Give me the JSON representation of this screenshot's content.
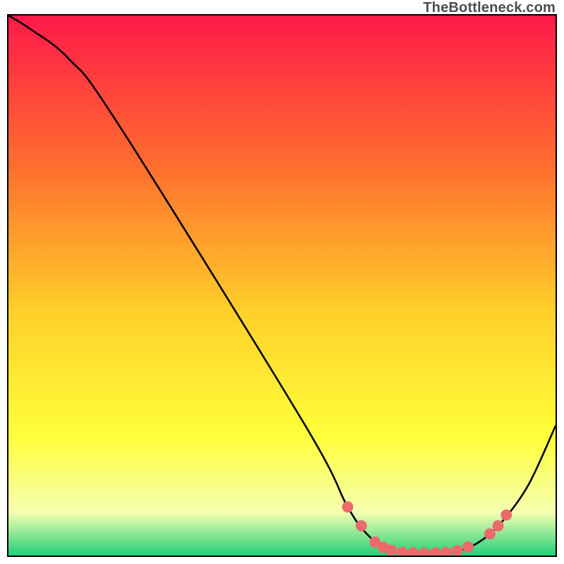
{
  "watermark": "TheBottleneck.com",
  "colors": {
    "border": "#000000",
    "curve": "#000000",
    "dot_fill": "#ec6a6a",
    "dot_stroke": "#a33b3b",
    "grad_top": "#ff1a4a",
    "grad_mid_upper": "#ff6e2e",
    "grad_mid": "#ffd02a",
    "grad_mid_lower": "#ffff3a",
    "grad_pale": "#f5ffb0",
    "grad_bottom": "#21d07a"
  },
  "chart_data": {
    "type": "line",
    "title": "",
    "xlabel": "",
    "ylabel": "",
    "xlim": [
      0,
      100
    ],
    "ylim": [
      0,
      100
    ],
    "curve": [
      {
        "x": 0,
        "y": 100
      },
      {
        "x": 4,
        "y": 97.5
      },
      {
        "x": 11,
        "y": 92
      },
      {
        "x": 20,
        "y": 80
      },
      {
        "x": 54,
        "y": 24.5
      },
      {
        "x": 62,
        "y": 9
      },
      {
        "x": 66,
        "y": 3.5
      },
      {
        "x": 70,
        "y": 1
      },
      {
        "x": 76,
        "y": 0.4
      },
      {
        "x": 82,
        "y": 0.8
      },
      {
        "x": 86,
        "y": 2.5
      },
      {
        "x": 90,
        "y": 6
      },
      {
        "x": 95,
        "y": 13
      },
      {
        "x": 100,
        "y": 24
      }
    ],
    "dots": [
      {
        "x": 62,
        "y": 9
      },
      {
        "x": 64.5,
        "y": 5.5
      },
      {
        "x": 67,
        "y": 2.5
      },
      {
        "x": 68.5,
        "y": 1.5
      },
      {
        "x": 70,
        "y": 1.0
      },
      {
        "x": 72,
        "y": 0.6
      },
      {
        "x": 74,
        "y": 0.5
      },
      {
        "x": 76,
        "y": 0.4
      },
      {
        "x": 78,
        "y": 0.5
      },
      {
        "x": 80,
        "y": 0.6
      },
      {
        "x": 82,
        "y": 0.9
      },
      {
        "x": 84,
        "y": 1.6
      },
      {
        "x": 88,
        "y": 4.0
      },
      {
        "x": 89.5,
        "y": 5.5
      },
      {
        "x": 91,
        "y": 7.5
      }
    ]
  }
}
